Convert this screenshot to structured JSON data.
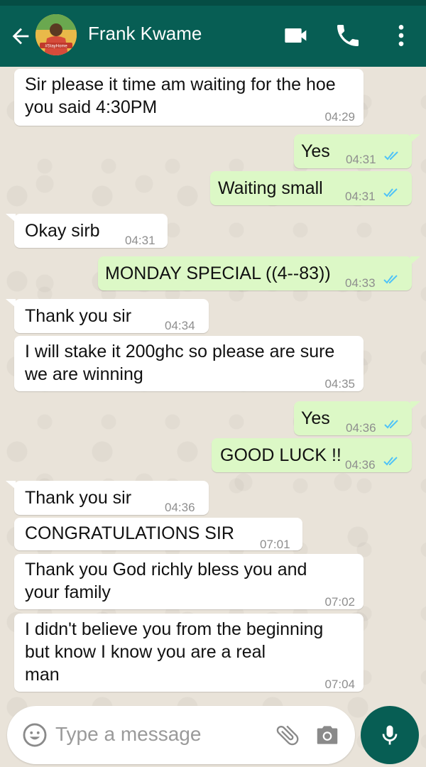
{
  "header": {
    "contact_name": "Frank Kwame",
    "avatar_badge": "#StayHome"
  },
  "messages": [
    {
      "dir": "in",
      "lines": [
        "Sir please it time am waiting for the hoe",
        "you said 4:30PM"
      ],
      "time": "04:29"
    },
    {
      "dir": "out",
      "lines": [
        "Yes"
      ],
      "time": "04:31",
      "read": true
    },
    {
      "dir": "out",
      "lines": [
        "Waiting small"
      ],
      "time": "04:31",
      "read": true
    },
    {
      "dir": "in",
      "lines": [
        "Okay sirb"
      ],
      "time": "04:31"
    },
    {
      "dir": "out",
      "lines": [
        "MONDAY SPECIAL ((4--83))"
      ],
      "time": "04:33",
      "read": true
    },
    {
      "dir": "in",
      "lines": [
        "Thank you sir"
      ],
      "time": "04:34"
    },
    {
      "dir": "in",
      "lines": [
        "I will stake it 200ghc so please are sure",
        "we are winning"
      ],
      "time": "04:35"
    },
    {
      "dir": "out",
      "lines": [
        "Yes"
      ],
      "time": "04:36",
      "read": true
    },
    {
      "dir": "out",
      "lines": [
        "GOOD LUCK !!"
      ],
      "time": "04:36",
      "read": true
    },
    {
      "dir": "in",
      "lines": [
        "Thank you sir"
      ],
      "time": "04:36"
    },
    {
      "dir": "in",
      "lines": [
        "CONGRATULATIONS SIR"
      ],
      "time": "07:01"
    },
    {
      "dir": "in",
      "lines": [
        "Thank you God richly bless you and",
        "your family"
      ],
      "time": "07:02"
    },
    {
      "dir": "in",
      "lines": [
        "I didn't believe you from the beginning",
        "but know I know you are a real",
        "man"
      ],
      "time": "07:04"
    }
  ],
  "input": {
    "placeholder": "Type a message"
  },
  "colors": {
    "header": "#075e54",
    "outgoing_bubble": "#dcf8c6",
    "incoming_bubble": "#ffffff",
    "read_ticks": "#4fc3f7"
  },
  "icons": {
    "back": "arrow-left",
    "video": "video-camera",
    "call": "phone",
    "menu": "vertical-dots",
    "emoji": "smiley",
    "attach": "paperclip",
    "camera": "camera",
    "mic": "microphone"
  }
}
